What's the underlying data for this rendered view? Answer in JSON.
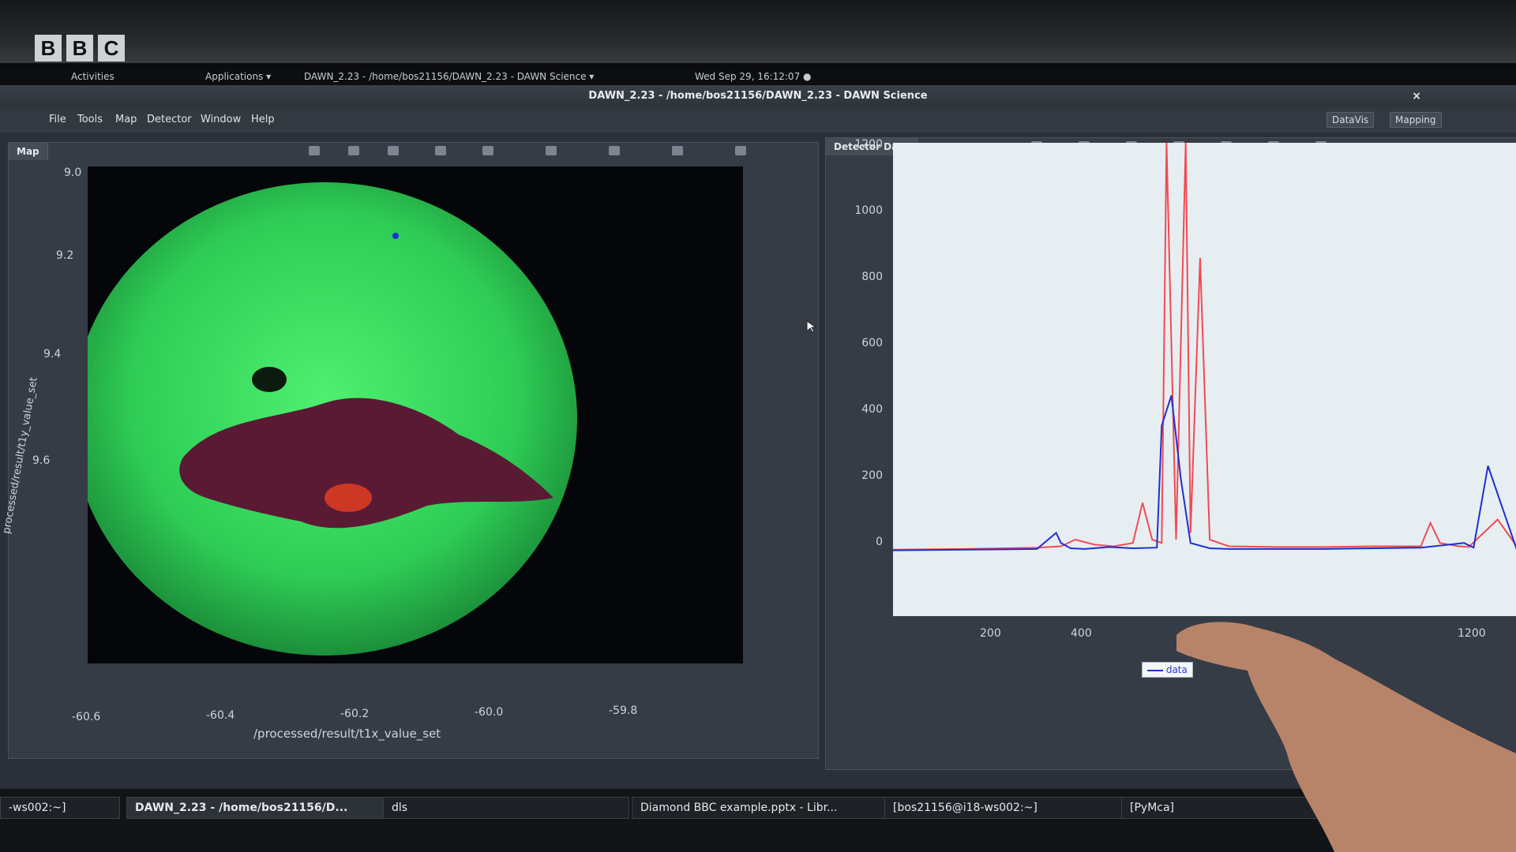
{
  "overlay": {
    "broadcaster_logo": [
      "B",
      "B",
      "C"
    ]
  },
  "top_bar": {
    "activities": "Activities",
    "applications": "Applications ▾",
    "app_indicator": "DAWN_2.23 - /home/bos21156/DAWN_2.23 - DAWN Science ▾",
    "clock": "Wed Sep 29, 16:12:07 ●"
  },
  "window": {
    "title": "DAWN_2.23 - /home/bos21156/DAWN_2.23 - DAWN Science",
    "close": "×"
  },
  "menubar": {
    "items": [
      "File",
      "Tools",
      "Map",
      "Detector",
      "Window",
      "Help"
    ],
    "perspectives": [
      "DataVis",
      "Mapping"
    ]
  },
  "map_panel": {
    "tab": "Map",
    "yticks": [
      "9.0",
      "9.2",
      "9.4",
      "9.6"
    ],
    "ylabel": "processed/result/t1y_value_set",
    "xticks": [
      "-60.6",
      "-60.4",
      "-60.2",
      "-60.0",
      "-59.8"
    ],
    "xlabel": "/processed/result/t1x_value_set"
  },
  "detector_panel": {
    "tab": "Detector Data",
    "legend": "data"
  },
  "chart_data": {
    "type": "line",
    "ylim": [
      0,
      1200
    ],
    "yticks": [
      "1200",
      "1000",
      "800",
      "600",
      "400",
      "200",
      "0"
    ],
    "xticks": [
      "200",
      "400",
      "1200"
    ],
    "xlim": [
      0,
      1300
    ],
    "series": [
      {
        "name": "data",
        "color": "#1f2fd0",
        "x": [
          0,
          150,
          300,
          340,
          350,
          370,
          400,
          450,
          500,
          550,
          560,
          580,
          600,
          620,
          660,
          700,
          800,
          900,
          1000,
          1100,
          1190,
          1210,
          1240,
          1300
        ],
        "y": [
          8,
          10,
          12,
          60,
          30,
          14,
          12,
          18,
          14,
          16,
          380,
          470,
          220,
          30,
          14,
          12,
          12,
          12,
          14,
          16,
          30,
          16,
          260,
          10
        ]
      },
      {
        "name": "",
        "color": "#f24a52",
        "x": [
          0,
          150,
          300,
          350,
          380,
          420,
          460,
          500,
          520,
          540,
          560,
          570,
          590,
          610,
          620,
          640,
          660,
          700,
          800,
          900,
          1000,
          1100,
          1120,
          1140,
          1180,
          1200,
          1260,
          1300
        ],
        "y": [
          10,
          12,
          16,
          20,
          40,
          25,
          20,
          30,
          150,
          40,
          30,
          1300,
          40,
          1300,
          60,
          880,
          40,
          20,
          18,
          18,
          20,
          20,
          90,
          30,
          20,
          18,
          100,
          20
        ]
      }
    ]
  },
  "taskbar": {
    "items": [
      "-ws002:~]",
      "DAWN_2.23 - /home/bos21156/D...",
      "dls",
      "Diamond BBC example.pptx - Libr...",
      "[bos21156@i18-ws002:~]",
      "[PyMca]"
    ]
  },
  "colors": {
    "map_green": "#33d45a",
    "plot_bg": "#e6eef2",
    "series_blue": "#1f2fd0",
    "series_red": "#f24a52"
  }
}
